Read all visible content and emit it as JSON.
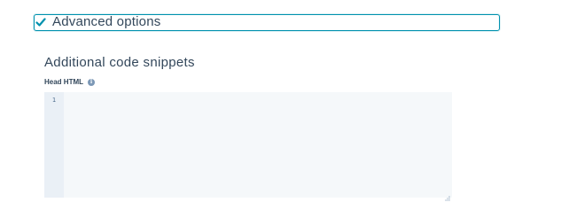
{
  "advanced_options": {
    "label": "Advanced options",
    "expanded": true,
    "icon": "check-icon",
    "accent_color": "#0091ae"
  },
  "code_snippets": {
    "title": "Additional code snippets",
    "head_html": {
      "label": "Head HTML",
      "info_icon": "info-icon",
      "info_glyph": "i",
      "line_numbers": [
        "1"
      ],
      "value": ""
    }
  }
}
